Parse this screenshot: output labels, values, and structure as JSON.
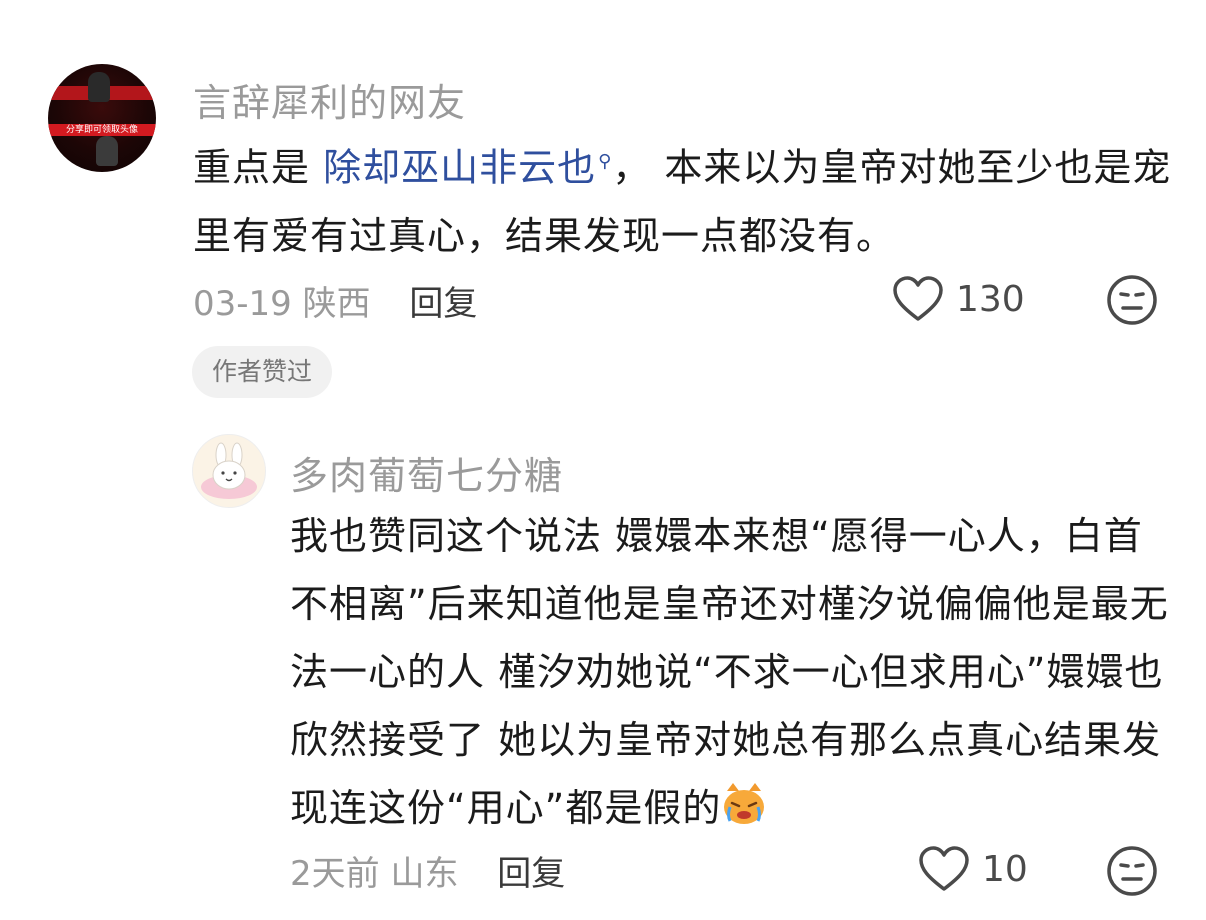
{
  "comments": [
    {
      "username": "言辞犀利的网友",
      "avatar_caption": "分享即可领取头像",
      "text_prefix": "重点是 ",
      "link_text": "除却巫山非云也",
      "link_icon": "search-icon",
      "text_rest": "， 本来以为皇帝对她至少也是宠里有爱有过真心，结果发现一点都没有。",
      "date": "03-19",
      "location": "陕西",
      "reply_label": "回复",
      "likes": "130",
      "badge": "作者赞过"
    },
    {
      "username": "多肉葡萄七分糖",
      "text": "我也赞同这个说法 嬛嬛本来想“愿得一心人，白首不相离”后来知道他是皇帝还对槿汐说偏偏他是最无法一心的人 槿汐劝她说“不求一心但求用心”嬛嬛也欣然接受了 她以为皇帝对她总有那么点真心结果发现连这份“用心”都是假的",
      "emoji": "crying-cat-emoji",
      "date": "2天前",
      "location": "山东",
      "reply_label": "回复",
      "likes": "10"
    }
  ],
  "colors": {
    "link": "#2f4f9e",
    "meta": "#9a9a9a",
    "badge_bg": "#f1f1f1"
  }
}
